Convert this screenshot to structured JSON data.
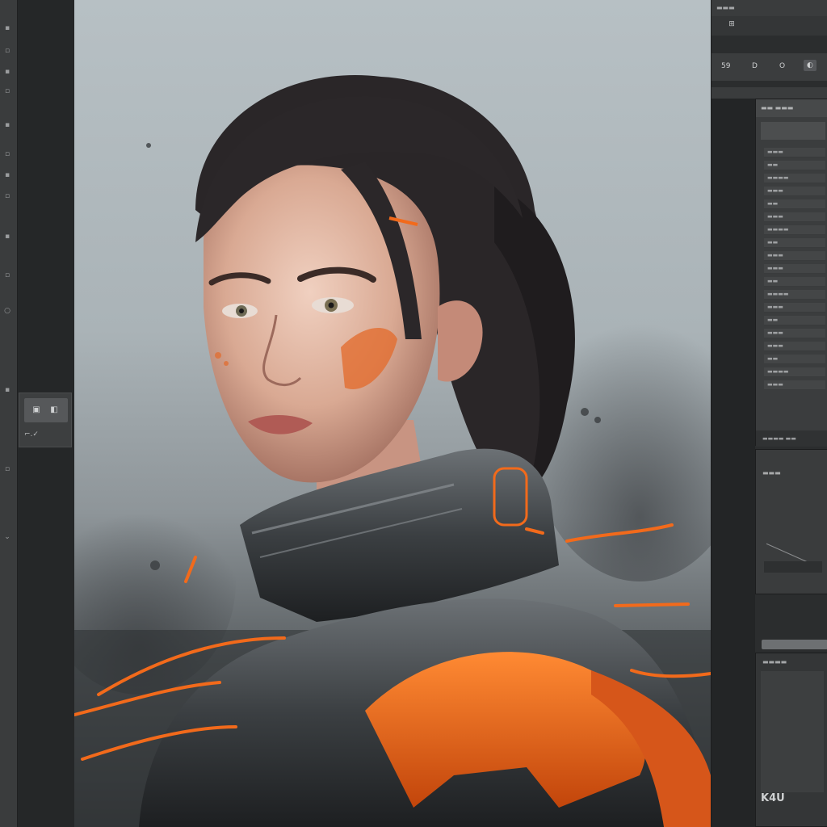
{
  "left_toolbar": {
    "tools": [
      "move-tool",
      "marquee-tool",
      "lasso-tool",
      "quick-select-tool",
      "crop-tool",
      "eyedropper-tool",
      "brush-tool",
      "eraser-tool",
      "gradient-tool",
      "pen-tool",
      "type-tool",
      "shape-tool",
      "zoom-tool"
    ]
  },
  "float_panel": {
    "icon_a": "▣",
    "icon_b": "◧",
    "label": "⌐.✓"
  },
  "right_dock": {
    "top_title": "▬▬▬",
    "tab_label": "⊞",
    "icons": [
      "59",
      "D",
      "O",
      "◐"
    ],
    "layers_header": "▬▬ ▬▬▬",
    "layers_footer": "▬▬▬▬ ▬▬",
    "props_title": "▬▬▬",
    "bottom_header": "▬▬▬▬",
    "bottom_footer": "K4U"
  },
  "colors": {
    "accent_orange": "#f26a1b",
    "background_sky": "#b7c0c4",
    "panel_bg": "#3b3d3e"
  }
}
